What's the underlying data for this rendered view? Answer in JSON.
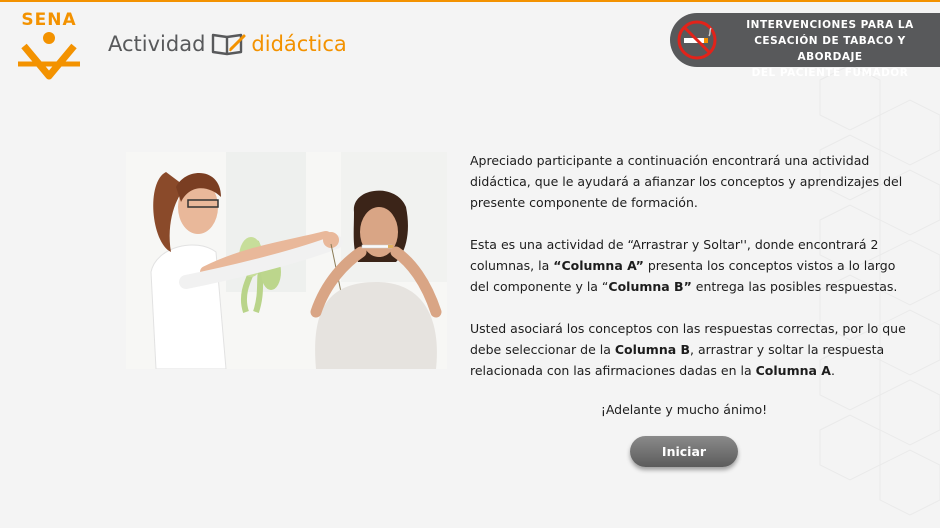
{
  "colors": {
    "accent": "#f39200",
    "dark_gray": "#58595b",
    "button": "#6d6d6d"
  },
  "header": {
    "logo_text": "SENA",
    "activity_word": "Actividad",
    "didactic_word": "didáctica",
    "course_title": [
      "INTERVENCIONES PARA LA",
      "CESACIÓN DE TABACO Y ABORDAJE",
      "DEL PACIENTE FUMADOR"
    ]
  },
  "icons": {
    "logo": "sena-logo-icon",
    "book": "book-pencil-icon",
    "no_smoking": "no-smoking-icon"
  },
  "content": {
    "para1": "Apreciado participante a continuación encontrará una actividad didáctica, que le ayudará a afianzar los conceptos y aprendizajes del presente componente de formación.",
    "para2": {
      "t1": "Esta es una actividad de “Arrastrar y Soltar'', donde encontrará 2 columnas, la ",
      "b1": "“Columna A”",
      "t2": " presenta los conceptos vistos a lo largo del componente y la “",
      "b2": "Columna B”",
      "t3": " entrega las posibles respuestas."
    },
    "para3": {
      "t1": "Usted asociará los conceptos con las respuestas correctas, por lo que debe seleccionar de la ",
      "b1": "Columna B",
      "t2": ", arrastrar y soltar la respuesta relacionada con las afirmaciones dadas en la ",
      "b2": "Columna A",
      "t3": "."
    },
    "closing": "¡Adelante y mucho ánimo!",
    "start_button": "Iniciar"
  }
}
